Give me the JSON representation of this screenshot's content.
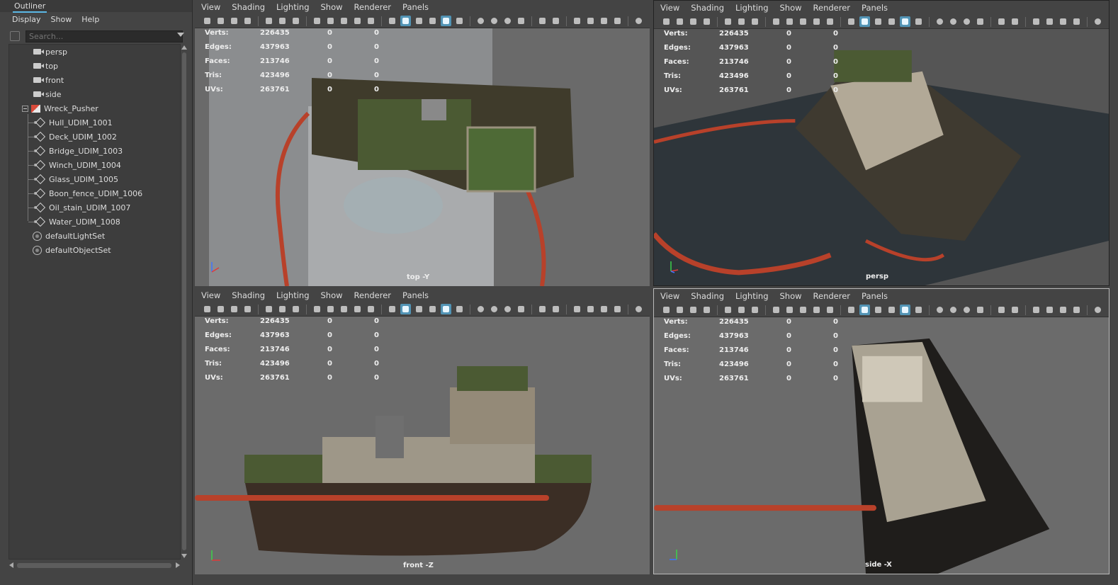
{
  "outliner": {
    "title": "Outliner",
    "menu": [
      "Display",
      "Show",
      "Help"
    ],
    "search_placeholder": "Search...",
    "items": [
      {
        "label": "persp",
        "icon": "camera-icon"
      },
      {
        "label": "top",
        "icon": "camera-icon"
      },
      {
        "label": "front",
        "icon": "camera-icon"
      },
      {
        "label": "side",
        "icon": "camera-icon"
      },
      {
        "label": "Wreck_Pusher",
        "icon": "group-icon"
      },
      {
        "label": "Hull_UDIM_1001",
        "icon": "mesh-icon"
      },
      {
        "label": "Deck_UDIM_1002",
        "icon": "mesh-icon"
      },
      {
        "label": "Bridge_UDIM_1003",
        "icon": "mesh-icon"
      },
      {
        "label": "Winch_UDIM_1004",
        "icon": "mesh-icon"
      },
      {
        "label": "Glass_UDIM_1005",
        "icon": "mesh-icon"
      },
      {
        "label": "Boon_fence_UDIM_1006",
        "icon": "mesh-icon"
      },
      {
        "label": "Oil_stain_UDIM_1007",
        "icon": "mesh-icon"
      },
      {
        "label": "Water_UDIM_1008",
        "icon": "mesh-icon"
      },
      {
        "label": "defaultLightSet",
        "icon": "set-icon"
      },
      {
        "label": "defaultObjectSet",
        "icon": "set-icon"
      }
    ]
  },
  "viewport_menu": [
    "View",
    "Shading",
    "Lighting",
    "Show",
    "Renderer",
    "Panels"
  ],
  "hud": {
    "labels": [
      "Verts:",
      "Edges:",
      "Faces:",
      "Tris:",
      "UVs:"
    ],
    "values": [
      "226435",
      "437963",
      "213746",
      "423496",
      "263761"
    ],
    "zero": "0"
  },
  "viewports": {
    "top": {
      "camera_label": "top -Y"
    },
    "persp": {
      "camera_label": "persp"
    },
    "front": {
      "camera_label": "front -Z"
    },
    "side": {
      "camera_label": "side -X"
    }
  },
  "colors": {
    "accent": "#5294b5",
    "boom": "#b8412a"
  }
}
